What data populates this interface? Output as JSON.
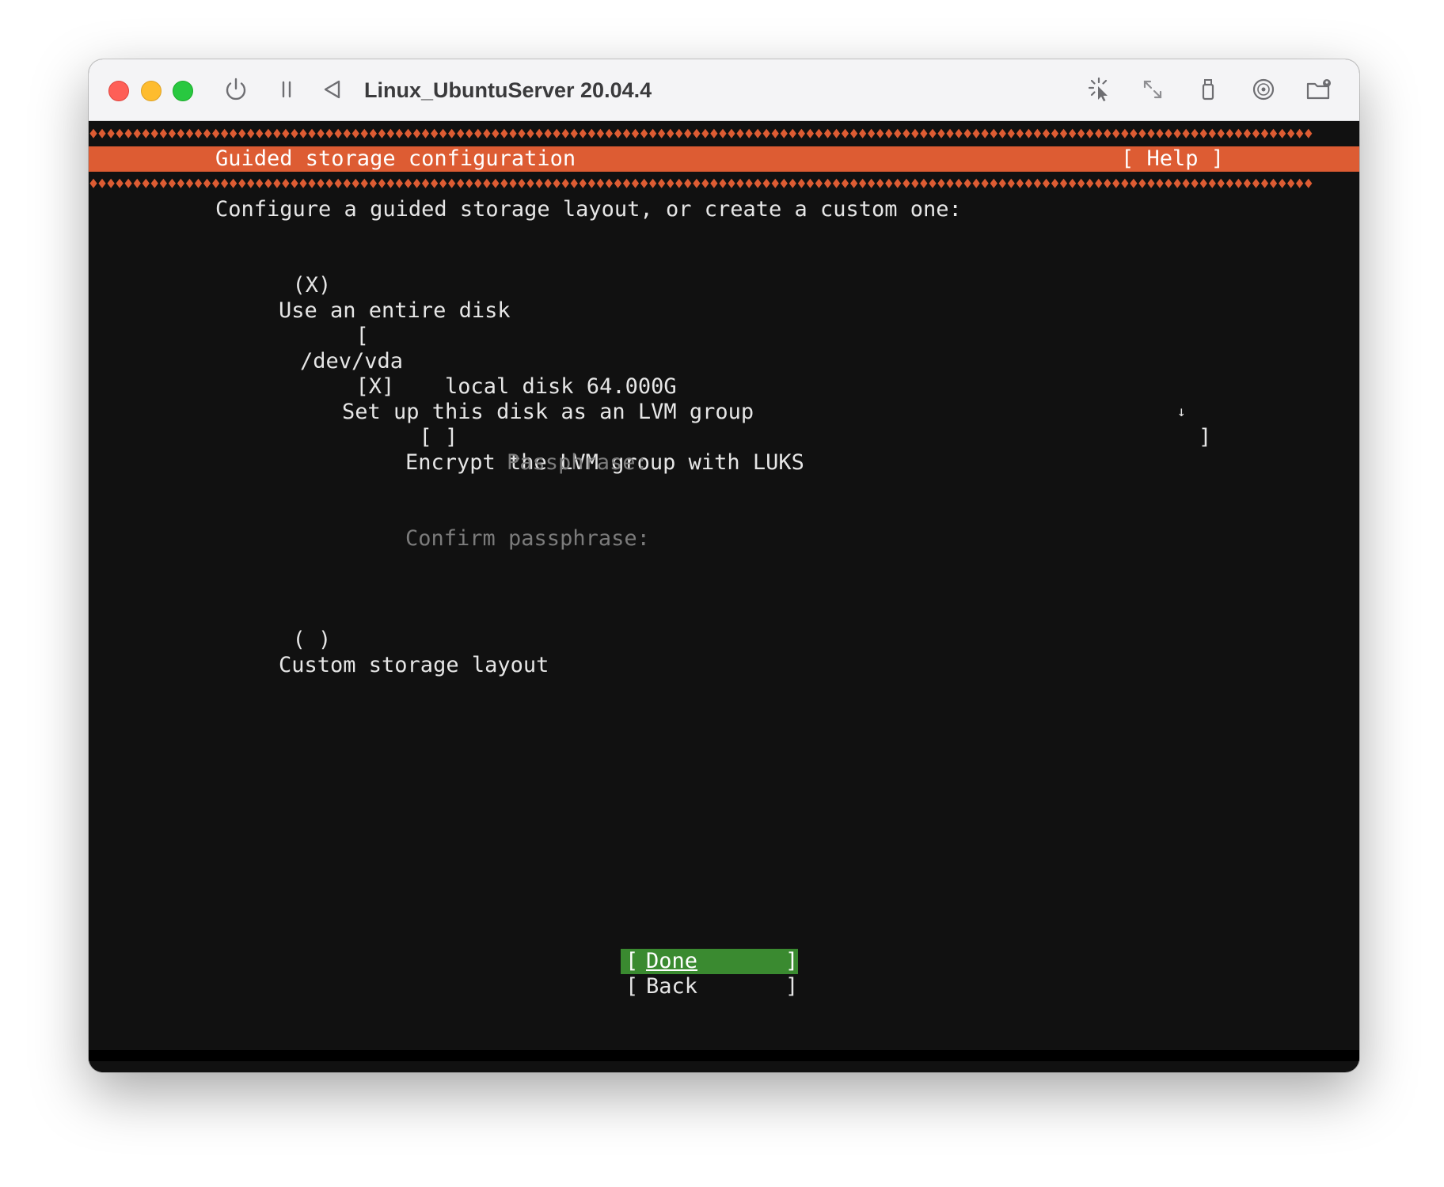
{
  "window": {
    "title": "Linux_UbuntuServer 20.04.4"
  },
  "toolbar": {
    "left_icons": [
      "power-icon",
      "pause-icon",
      "back-triangle-icon"
    ],
    "right_icons": [
      "cursor-capture-icon",
      "resize-arrows-icon",
      "usb-icon",
      "disc-icon",
      "shared-folder-icon"
    ]
  },
  "installer": {
    "header_title": "Guided storage configuration",
    "help_label": "[ Help ]",
    "prompt": "Configure a guided storage layout, or create a custom one:",
    "option_entire_disk": {
      "marker": "(X)",
      "label": "Use an entire disk"
    },
    "disk_select": {
      "open": "[",
      "device": "/dev/vda",
      "description": "local disk 64.000G",
      "arrow": "↓",
      "close": "]"
    },
    "lvm_option": {
      "marker": "[X]",
      "label": "Set up this disk as an LVM group"
    },
    "luks_option": {
      "marker": "[ ]",
      "label": "Encrypt the LVM group with LUKS"
    },
    "passphrase_label": "Passphrase:",
    "confirm_passphrase_label": "Confirm passphrase:",
    "option_custom": {
      "marker": "( )",
      "label": "Custom storage layout"
    },
    "buttons": {
      "done": {
        "open": "[",
        "label": "Done",
        "close": "]"
      },
      "back": {
        "open": "[",
        "label": "Back",
        "close": "]"
      }
    }
  },
  "colors": {
    "accent": "#dd5c33",
    "terminal_bg": "#111111",
    "button_active": "#3a8a30"
  }
}
